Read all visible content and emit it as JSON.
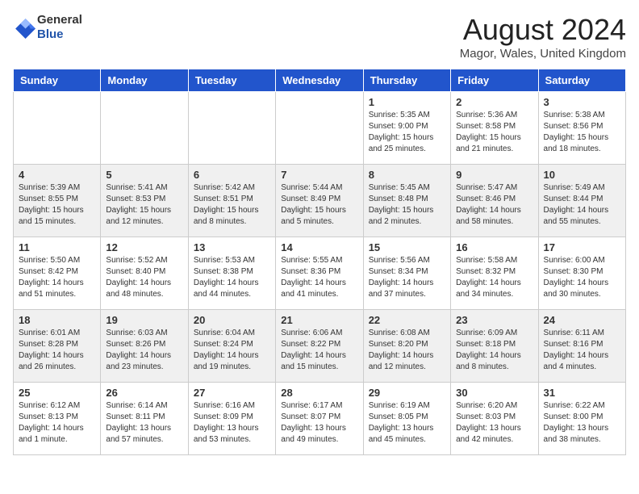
{
  "header": {
    "logo_general": "General",
    "logo_blue": "Blue",
    "month_title": "August 2024",
    "subtitle": "Magor, Wales, United Kingdom"
  },
  "days_of_week": [
    "Sunday",
    "Monday",
    "Tuesday",
    "Wednesday",
    "Thursday",
    "Friday",
    "Saturday"
  ],
  "weeks": [
    [
      {
        "day": "",
        "info": ""
      },
      {
        "day": "",
        "info": ""
      },
      {
        "day": "",
        "info": ""
      },
      {
        "day": "",
        "info": ""
      },
      {
        "day": "1",
        "info": "Sunrise: 5:35 AM\nSunset: 9:00 PM\nDaylight: 15 hours\nand 25 minutes."
      },
      {
        "day": "2",
        "info": "Sunrise: 5:36 AM\nSunset: 8:58 PM\nDaylight: 15 hours\nand 21 minutes."
      },
      {
        "day": "3",
        "info": "Sunrise: 5:38 AM\nSunset: 8:56 PM\nDaylight: 15 hours\nand 18 minutes."
      }
    ],
    [
      {
        "day": "4",
        "info": "Sunrise: 5:39 AM\nSunset: 8:55 PM\nDaylight: 15 hours\nand 15 minutes."
      },
      {
        "day": "5",
        "info": "Sunrise: 5:41 AM\nSunset: 8:53 PM\nDaylight: 15 hours\nand 12 minutes."
      },
      {
        "day": "6",
        "info": "Sunrise: 5:42 AM\nSunset: 8:51 PM\nDaylight: 15 hours\nand 8 minutes."
      },
      {
        "day": "7",
        "info": "Sunrise: 5:44 AM\nSunset: 8:49 PM\nDaylight: 15 hours\nand 5 minutes."
      },
      {
        "day": "8",
        "info": "Sunrise: 5:45 AM\nSunset: 8:48 PM\nDaylight: 15 hours\nand 2 minutes."
      },
      {
        "day": "9",
        "info": "Sunrise: 5:47 AM\nSunset: 8:46 PM\nDaylight: 14 hours\nand 58 minutes."
      },
      {
        "day": "10",
        "info": "Sunrise: 5:49 AM\nSunset: 8:44 PM\nDaylight: 14 hours\nand 55 minutes."
      }
    ],
    [
      {
        "day": "11",
        "info": "Sunrise: 5:50 AM\nSunset: 8:42 PM\nDaylight: 14 hours\nand 51 minutes."
      },
      {
        "day": "12",
        "info": "Sunrise: 5:52 AM\nSunset: 8:40 PM\nDaylight: 14 hours\nand 48 minutes."
      },
      {
        "day": "13",
        "info": "Sunrise: 5:53 AM\nSunset: 8:38 PM\nDaylight: 14 hours\nand 44 minutes."
      },
      {
        "day": "14",
        "info": "Sunrise: 5:55 AM\nSunset: 8:36 PM\nDaylight: 14 hours\nand 41 minutes."
      },
      {
        "day": "15",
        "info": "Sunrise: 5:56 AM\nSunset: 8:34 PM\nDaylight: 14 hours\nand 37 minutes."
      },
      {
        "day": "16",
        "info": "Sunrise: 5:58 AM\nSunset: 8:32 PM\nDaylight: 14 hours\nand 34 minutes."
      },
      {
        "day": "17",
        "info": "Sunrise: 6:00 AM\nSunset: 8:30 PM\nDaylight: 14 hours\nand 30 minutes."
      }
    ],
    [
      {
        "day": "18",
        "info": "Sunrise: 6:01 AM\nSunset: 8:28 PM\nDaylight: 14 hours\nand 26 minutes."
      },
      {
        "day": "19",
        "info": "Sunrise: 6:03 AM\nSunset: 8:26 PM\nDaylight: 14 hours\nand 23 minutes."
      },
      {
        "day": "20",
        "info": "Sunrise: 6:04 AM\nSunset: 8:24 PM\nDaylight: 14 hours\nand 19 minutes."
      },
      {
        "day": "21",
        "info": "Sunrise: 6:06 AM\nSunset: 8:22 PM\nDaylight: 14 hours\nand 15 minutes."
      },
      {
        "day": "22",
        "info": "Sunrise: 6:08 AM\nSunset: 8:20 PM\nDaylight: 14 hours\nand 12 minutes."
      },
      {
        "day": "23",
        "info": "Sunrise: 6:09 AM\nSunset: 8:18 PM\nDaylight: 14 hours\nand 8 minutes."
      },
      {
        "day": "24",
        "info": "Sunrise: 6:11 AM\nSunset: 8:16 PM\nDaylight: 14 hours\nand 4 minutes."
      }
    ],
    [
      {
        "day": "25",
        "info": "Sunrise: 6:12 AM\nSunset: 8:13 PM\nDaylight: 14 hours\nand 1 minute."
      },
      {
        "day": "26",
        "info": "Sunrise: 6:14 AM\nSunset: 8:11 PM\nDaylight: 13 hours\nand 57 minutes."
      },
      {
        "day": "27",
        "info": "Sunrise: 6:16 AM\nSunset: 8:09 PM\nDaylight: 13 hours\nand 53 minutes."
      },
      {
        "day": "28",
        "info": "Sunrise: 6:17 AM\nSunset: 8:07 PM\nDaylight: 13 hours\nand 49 minutes."
      },
      {
        "day": "29",
        "info": "Sunrise: 6:19 AM\nSunset: 8:05 PM\nDaylight: 13 hours\nand 45 minutes."
      },
      {
        "day": "30",
        "info": "Sunrise: 6:20 AM\nSunset: 8:03 PM\nDaylight: 13 hours\nand 42 minutes."
      },
      {
        "day": "31",
        "info": "Sunrise: 6:22 AM\nSunset: 8:00 PM\nDaylight: 13 hours\nand 38 minutes."
      }
    ]
  ]
}
